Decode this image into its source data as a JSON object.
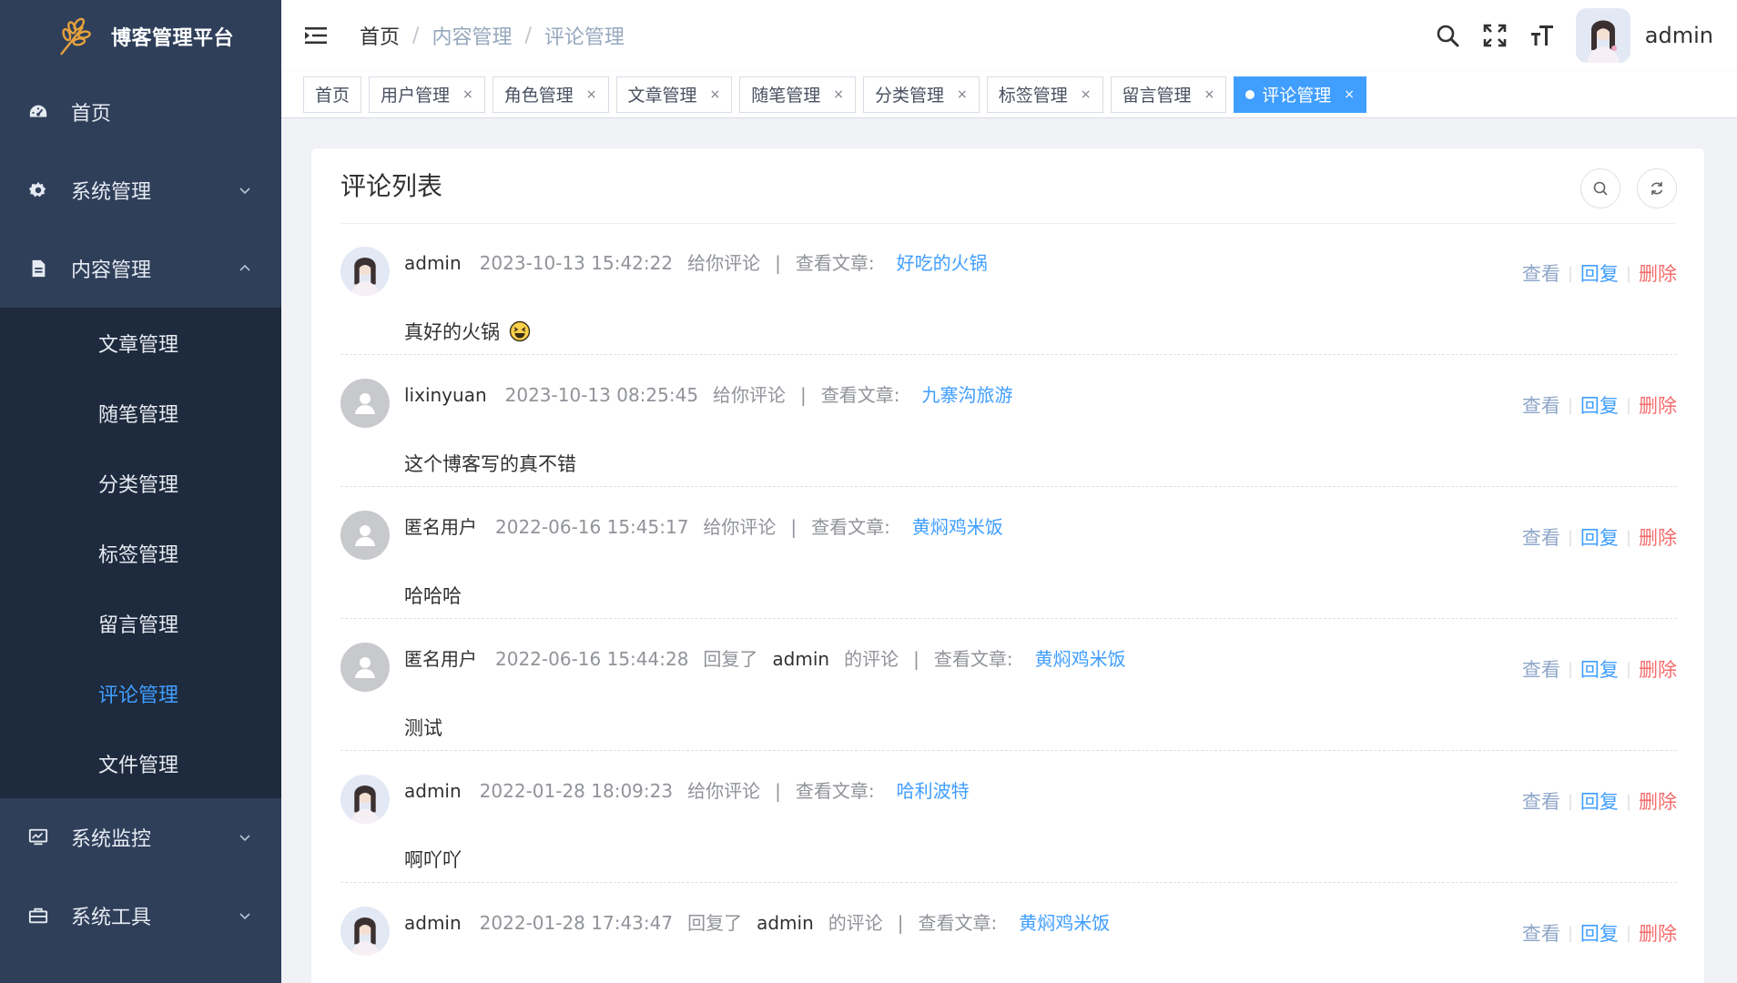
{
  "app": {
    "title": "博客管理平台"
  },
  "sidebar": {
    "items": [
      {
        "label": "首页",
        "icon": "dashboard-icon"
      },
      {
        "label": "系统管理",
        "icon": "gear-icon"
      },
      {
        "label": "内容管理",
        "icon": "document-icon"
      },
      {
        "label": "系统监控",
        "icon": "monitor-icon"
      },
      {
        "label": "系统工具",
        "icon": "toolbox-icon"
      }
    ],
    "submenu": [
      {
        "label": "文章管理"
      },
      {
        "label": "随笔管理"
      },
      {
        "label": "分类管理"
      },
      {
        "label": "标签管理"
      },
      {
        "label": "留言管理"
      },
      {
        "label": "评论管理",
        "active": true
      },
      {
        "label": "文件管理"
      }
    ]
  },
  "header": {
    "breadcrumb": [
      "首页",
      "内容管理",
      "评论管理"
    ],
    "separator": "/",
    "username": "admin"
  },
  "tags": [
    {
      "label": "首页",
      "closable": false
    },
    {
      "label": "用户管理",
      "closable": true
    },
    {
      "label": "角色管理",
      "closable": true
    },
    {
      "label": "文章管理",
      "closable": true
    },
    {
      "label": "随笔管理",
      "closable": true
    },
    {
      "label": "分类管理",
      "closable": true
    },
    {
      "label": "标签管理",
      "closable": true
    },
    {
      "label": "留言管理",
      "closable": true
    },
    {
      "label": "评论管理",
      "closable": true,
      "active": true
    }
  ],
  "tag_close_glyph": "×",
  "card": {
    "title": "评论列表"
  },
  "labels": {
    "bar": "|",
    "view_article": "查看文章:",
    "op_view": "查看",
    "op_reply": "回复",
    "op_delete": "删除",
    "op_sep": "|",
    "of_comment": "的评论"
  },
  "comments": [
    {
      "user": "admin",
      "time": "2023-10-13 15:42:22",
      "action": "给你评论",
      "target": "",
      "article": "好吃的火锅",
      "text": "真好的火锅",
      "emoji": true,
      "avatar": "photo"
    },
    {
      "user": "lixinyuan",
      "time": "2023-10-13 08:25:45",
      "action": "给你评论",
      "target": "",
      "article": "九寨沟旅游",
      "text": "这个博客写的真不错",
      "emoji": false,
      "avatar": "default"
    },
    {
      "user": "匿名用户",
      "time": "2022-06-16 15:45:17",
      "action": "给你评论",
      "target": "",
      "article": "黄焖鸡米饭",
      "text": "哈哈哈",
      "emoji": false,
      "avatar": "default"
    },
    {
      "user": "匿名用户",
      "time": "2022-06-16 15:44:28",
      "action": "回复了",
      "target": "admin",
      "article": "黄焖鸡米饭",
      "text": "测试",
      "emoji": false,
      "avatar": "default"
    },
    {
      "user": "admin",
      "time": "2022-01-28 18:09:23",
      "action": "给你评论",
      "target": "",
      "article": "哈利波特",
      "text": "啊吖吖",
      "emoji": false,
      "avatar": "photo"
    },
    {
      "user": "admin",
      "time": "2022-01-28 17:43:47",
      "action": "回复了",
      "target": "admin",
      "article": "黄焖鸡米饭",
      "text": "",
      "emoji": false,
      "avatar": "photo"
    }
  ],
  "colors": {
    "sidebar_bg": "#2f3f5a",
    "submenu_bg": "#1e2a3d",
    "accent": "#409eff",
    "danger": "#f56c6c"
  }
}
